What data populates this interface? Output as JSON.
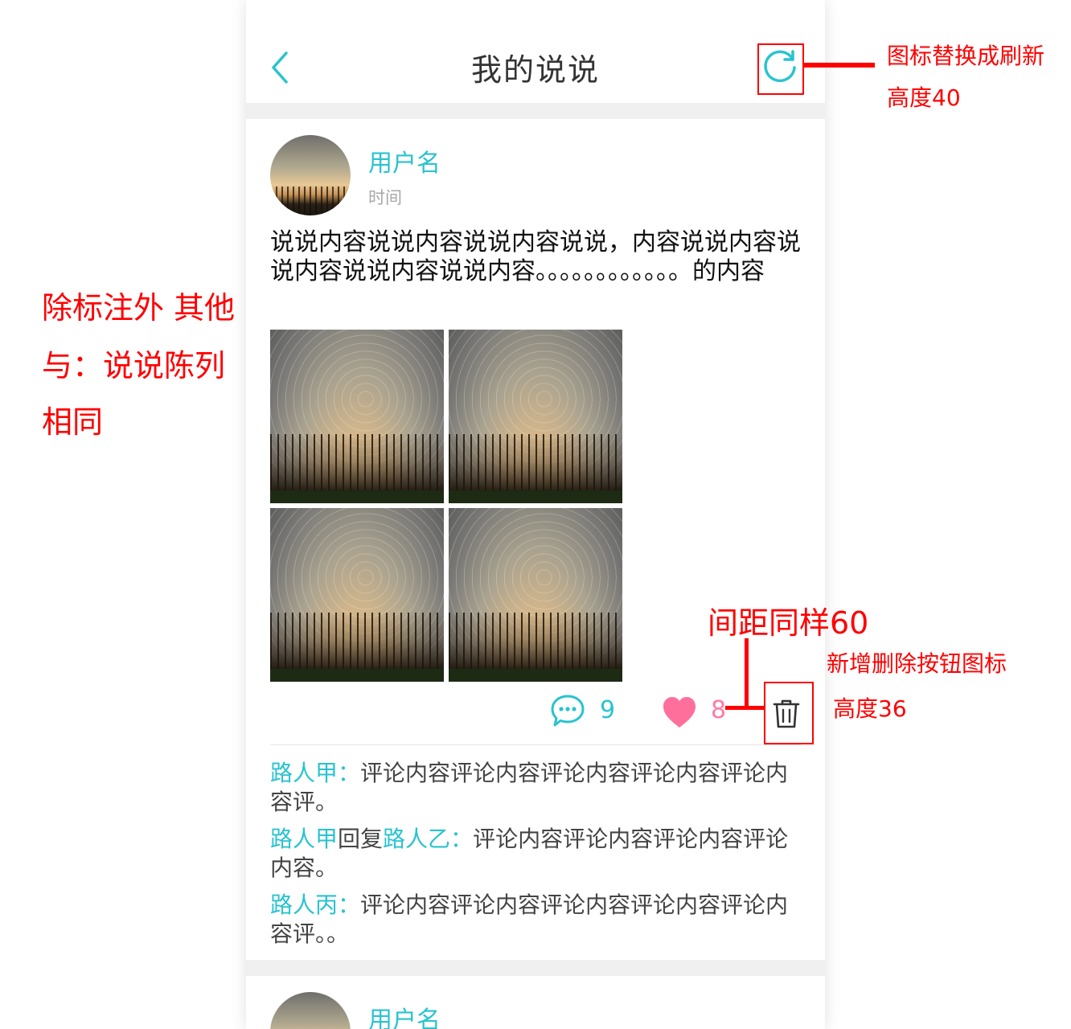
{
  "header": {
    "title": "我的说说"
  },
  "post": {
    "username": "用户名",
    "time": "时间",
    "content": "说说内容说说内容说说内容说说，内容说说内容说说内容说说内容说说内容。。。。。。。。。。。。的内容",
    "photo_count": 4,
    "comment_count": "9",
    "like_count": "8",
    "comments": [
      {
        "author": "路人甲",
        "separator": "：",
        "text": "评论内容评论内容评论内容评论内容评论内容评。"
      },
      {
        "author": "路人甲",
        "reply_word": "回复",
        "reply_to": "路人乙",
        "separator": "：",
        "text": "评论内容评论内容评论内容评论内容。"
      },
      {
        "author": "路人丙",
        "separator": "：",
        "text": "评论内容评论内容评论内容评论内容评论内容评。。"
      }
    ]
  },
  "next_post": {
    "username": "用户名"
  },
  "annotations": {
    "refresh_line1": "图标替换成刷新",
    "refresh_line2": "高度40",
    "left_line1": "除标注外 其他",
    "left_line2": "与：说说陈列",
    "left_line3": "相同",
    "spacing_note": "间距同样60",
    "delete_line1": "新增删除按钮图标",
    "delete_line2": "高度36"
  },
  "colors": {
    "accent": "#29c3d0",
    "like": "#ff7aa2",
    "annotation": "#ff0000",
    "background": "#f0f0f0"
  },
  "icons": {
    "back": "chevron-left-icon",
    "refresh": "refresh-icon",
    "comment": "comment-bubble-icon",
    "like": "heart-icon",
    "delete": "trash-icon"
  }
}
